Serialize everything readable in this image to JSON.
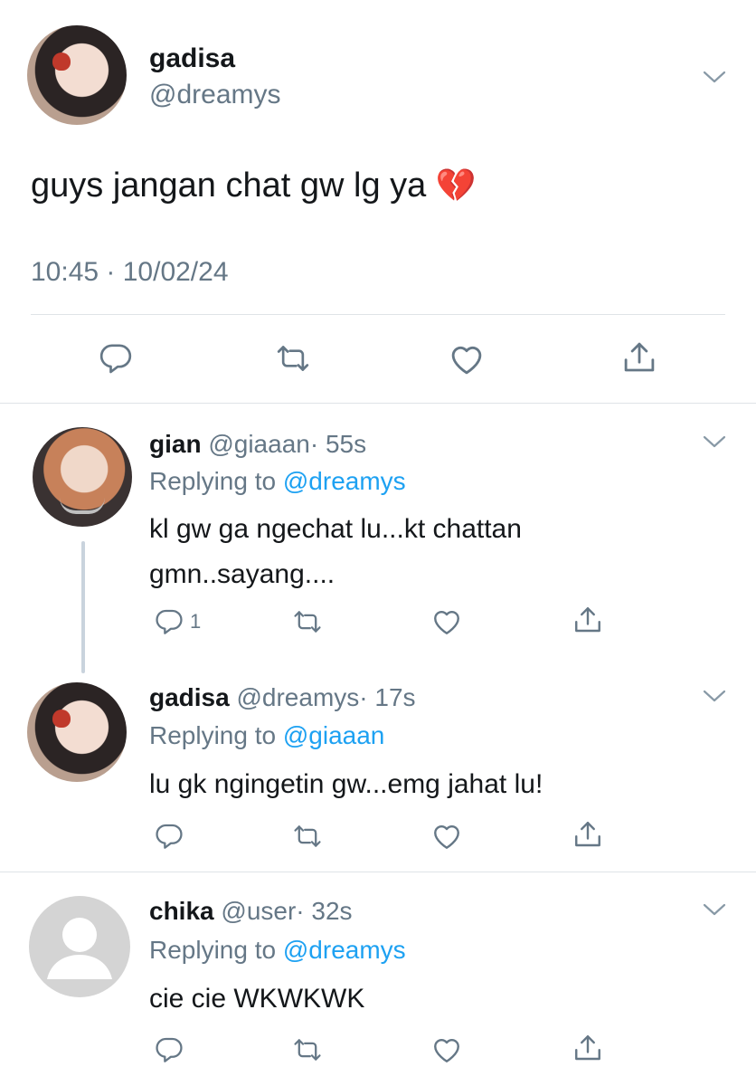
{
  "main_tweet": {
    "display_name": "gadisa",
    "handle": "@dreamys",
    "text": "guys jangan chat gw lg ya",
    "emoji": "💔",
    "timestamp": "10:45 · 10/02/24"
  },
  "replies": [
    {
      "display_name": "gian",
      "handle": "@giaaan",
      "time": "· 55s",
      "replying_label": "Replying to",
      "replying_to": "@dreamys",
      "text_line1": "kl gw ga ngechat lu...kt chattan",
      "text_line2": "gmn..sayang....",
      "reply_count": "1"
    },
    {
      "display_name": "gadisa",
      "handle": "@dreamys",
      "time": "· 17s",
      "replying_label": "Replying to",
      "replying_to": "@giaaan",
      "text_line1": "lu gk ngingetin gw...emg jahat lu!"
    },
    {
      "display_name": "chika",
      "handle": "@user",
      "time": "· 32s",
      "replying_label": "Replying to",
      "replying_to": "@dreamys",
      "text_line1": "cie cie WKWKWK"
    }
  ],
  "icons": [
    "chevron-down-icon",
    "reply-icon",
    "retweet-icon",
    "like-icon",
    "share-icon",
    "default-avatar-icon"
  ],
  "colors": {
    "link": "#1da1f2",
    "muted": "#657786",
    "divider": "#dfe3e7",
    "thread_line": "#c9d3dd"
  }
}
